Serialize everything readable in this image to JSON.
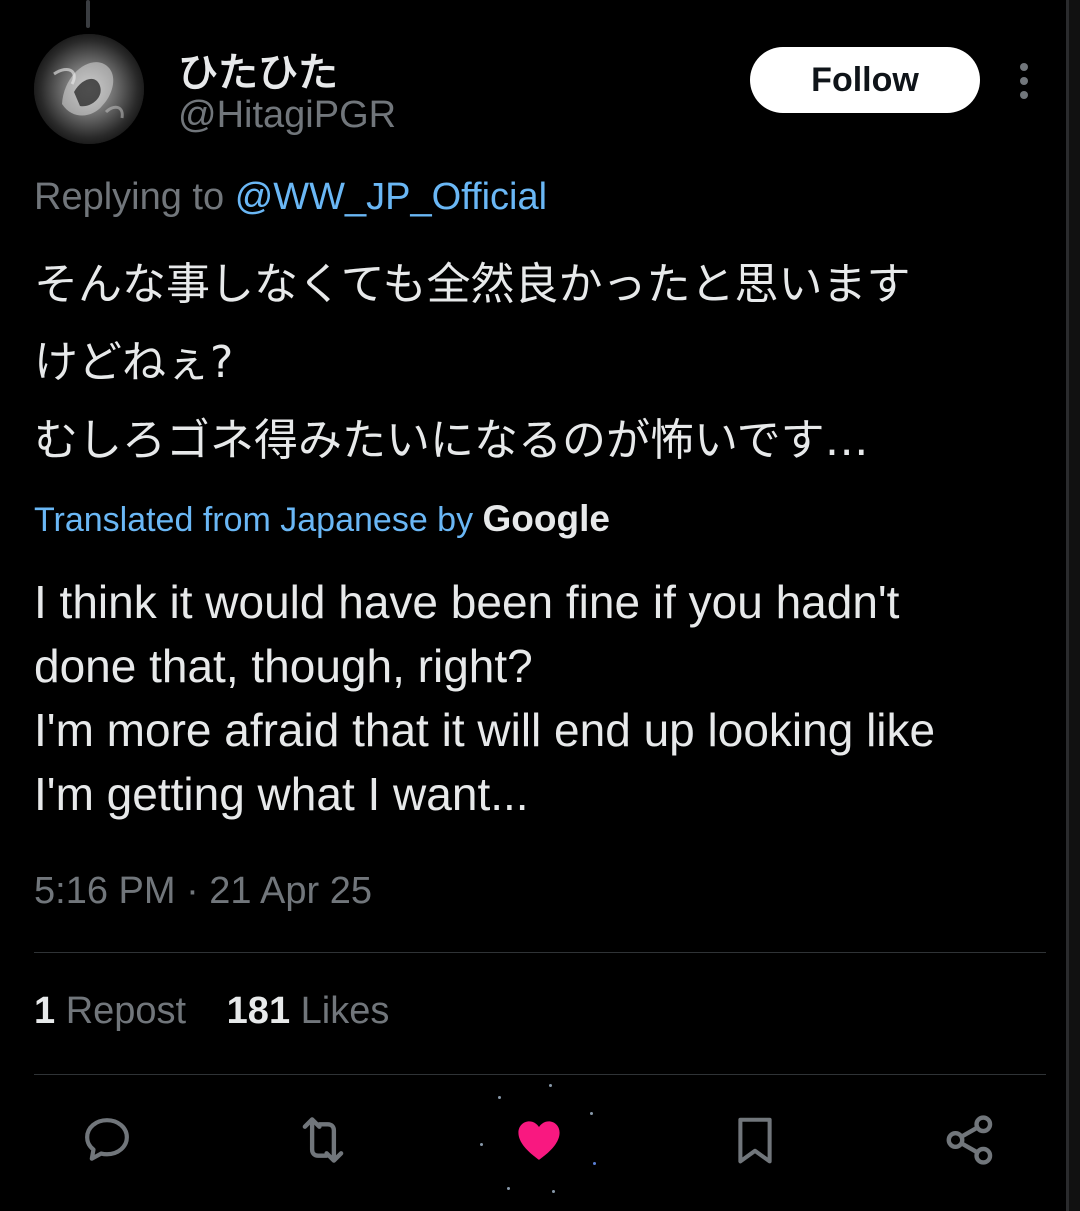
{
  "author": {
    "display_name": "ひたひた",
    "handle": "@HitagiPGR"
  },
  "follow_label": "Follow",
  "reply": {
    "prefix": "Replying to",
    "target": "@WW_JP_Official"
  },
  "post": {
    "original_text": "そんな事しなくても全然良かったと思います\nけどねぇ?\nむしろゴネ得みたいになるのが怖いです…",
    "translation_label": "Translated from Japanese by",
    "translation_provider": "Google",
    "translated_text": "I think it would have been fine if you hadn't\ndone that, though, right?\nI'm more afraid that it will end up looking like\nI'm getting what I want...",
    "timestamp": "5:16 PM · 21 Apr 25"
  },
  "stats": {
    "reposts_count": "1",
    "reposts_label": "Repost",
    "likes_count": "181",
    "likes_label": "Likes"
  },
  "actions": {
    "reply_icon": "speech-bubble-icon",
    "repost_icon": "repost-arrows-icon",
    "like_icon": "heart-filled-icon",
    "bookmark_icon": "bookmark-icon",
    "share_icon": "share-nodes-icon"
  },
  "colors": {
    "background": "#000000",
    "text_primary": "#e7e9ea",
    "text_secondary": "#71767b",
    "link": "#6ab7f5",
    "like_active": "#f91880",
    "follow_bg": "#ffffff"
  }
}
